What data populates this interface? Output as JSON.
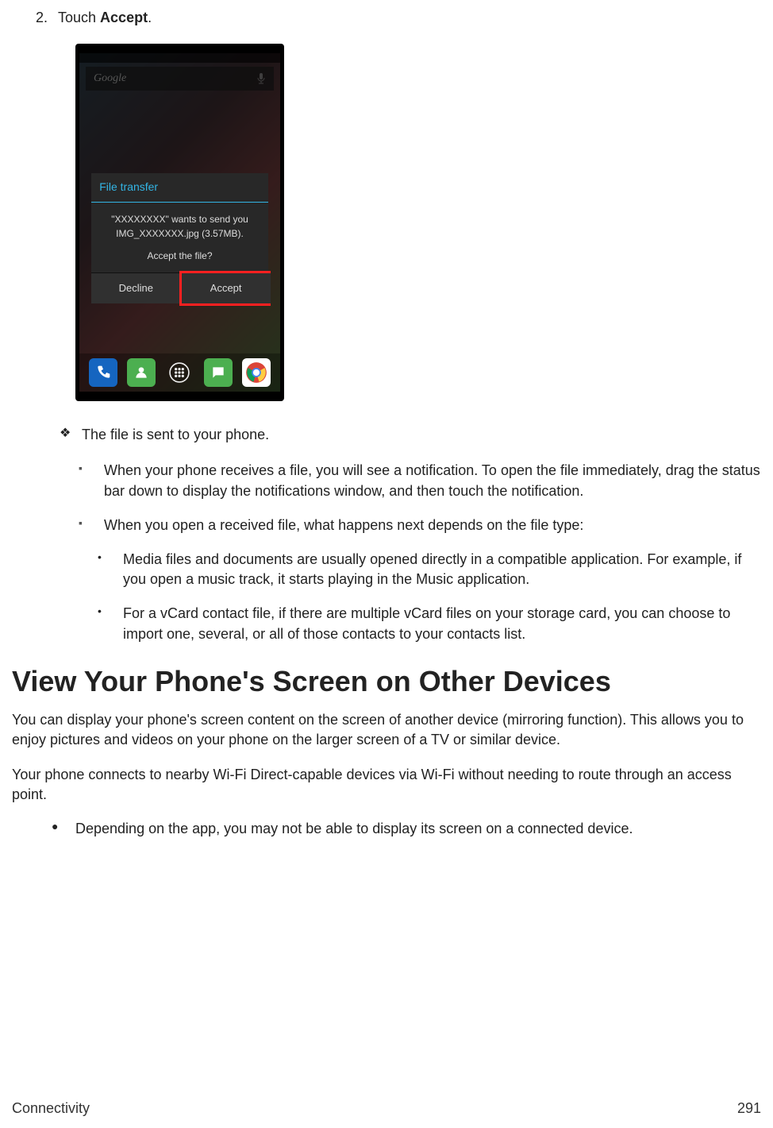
{
  "step": {
    "num": "2.",
    "text_pre": "Touch ",
    "text_bold": "Accept",
    "text_post": "."
  },
  "phone": {
    "google": "Google",
    "dialog_title": "File transfer",
    "dialog_line1": "\"XXXXXXXX\" wants to send you",
    "dialog_line2": "IMG_XXXXXXX.jpg (3.57MB).",
    "dialog_line3": "Accept the file?",
    "decline": "Decline",
    "accept": "Accept"
  },
  "diamond": "The file is sent to your phone.",
  "square1": "When your phone receives a file, you will see a notification. To open the file immediately, drag the status bar down to display the notifications window, and then touch the notification.",
  "square2": "When you open a received file, what happens next depends on the file type:",
  "dot1": "Media files and documents are usually opened directly in a compatible application. For example, if you open a music track, it starts playing in the Music application.",
  "dot2": "For a vCard contact file, if there are multiple vCard files on your storage card, you can choose to import one, several, or all of those contacts to your contacts list.",
  "heading": "View Your Phone's Screen on Other Devices",
  "para1": "You can display your phone's screen content on the screen of another device (mirroring function). This allows you to enjoy pictures and videos on your phone on the larger screen of a TV or similar device.",
  "para2": "Your phone connects to nearby Wi-Fi Direct-capable devices via Wi-Fi without needing to route through an access point.",
  "disc1": "Depending on the app, you may not be able to display its screen on a connected device.",
  "footer": {
    "section": "Connectivity",
    "page": "291"
  }
}
